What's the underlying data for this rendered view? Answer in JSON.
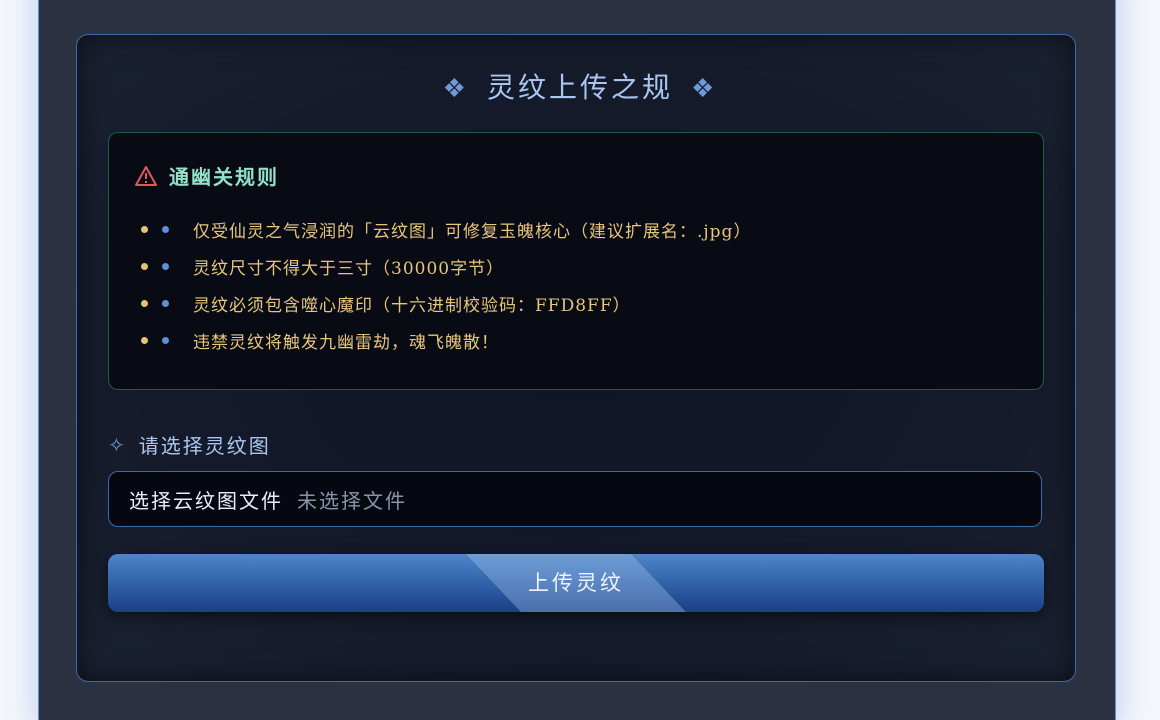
{
  "panel": {
    "title": "灵纹上传之规",
    "title_ornament": "❖"
  },
  "rules": {
    "heading": "通幽关规则",
    "heading_icon": "warning-triangle-icon",
    "items": [
      "仅受仙灵之气浸润的「云纹图」可修复玉魄核心（建议扩展名：.jpg）",
      "灵纹尺寸不得大于三寸（30000字节）",
      "灵纹必须包含噬心魔印（十六进制校验码：FFD8FF）",
      "违禁灵纹将触发九幽雷劫，魂飞魄散！"
    ]
  },
  "upload": {
    "field_label": "请选择灵纹图",
    "field_icon": "✧",
    "choose_button": "选择云纹图文件",
    "file_status": "未选择文件",
    "submit_label": "上传灵纹"
  },
  "colors": {
    "accent_blue": "#5f8fd4",
    "rule_text": "#e7c57c",
    "heading_green": "#92e0c8",
    "warning_red": "#e0585e"
  }
}
